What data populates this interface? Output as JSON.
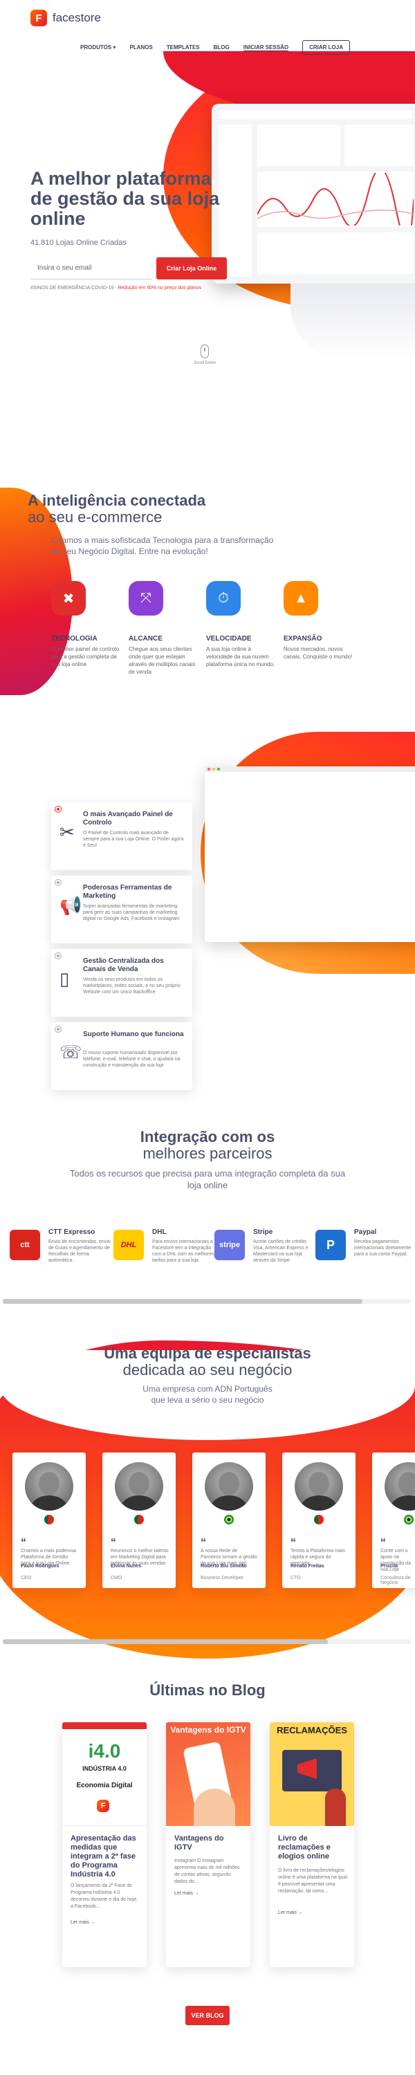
{
  "header": {
    "brand": "facestore",
    "nav": [
      {
        "label": "PRODUTOS ▾"
      },
      {
        "label": "PLANOS"
      },
      {
        "label": "TEMPLATES"
      },
      {
        "label": "BLOG"
      },
      {
        "label": "INICIAR SESSÃO"
      },
      {
        "label": "CRIAR LOJA"
      }
    ]
  },
  "hero": {
    "title_1": "A melhor plataforma",
    "title_2": "de gestão da sua loja",
    "title_3": "online",
    "stores": "41.810 Lojas Online Criadas",
    "email_placeholder": "Insira o seu email",
    "cta": "Criar Loja Online",
    "covid_prefix": "#SINOS DE EMERGÊNCIA COVID-19 -",
    "covid_offer": "Redução em 50% no preço dos planos",
    "scroll": "Scroll Down"
  },
  "intel": {
    "title_1": "A inteligência conectada",
    "title_2": "ao seu e-commerce",
    "sub_1": "Criamos a mais sofisticada Tecnologia para a transformação",
    "sub_2": "do seu Negócio Digital. Entre na evolução!",
    "features": [
      {
        "icon": "wrench-cross-icon",
        "title": "TECNOLOGIA",
        "text": "O melhor painel de controlo para a gestão completa da sua loja online",
        "color": "#e32c2c"
      },
      {
        "icon": "share-icon",
        "title": "ALCANCE",
        "text": "Chegue aos seus clientes onde quer que estejam através de múltiplos canais de venda",
        "color": "#8b3fd6"
      },
      {
        "icon": "stopwatch-icon",
        "title": "VELOCIDADE",
        "text": "A sua loja online à velocidade da sua nuvem plataforma única no mundo.",
        "color": "#2f86e8"
      },
      {
        "icon": "navigation-icon",
        "title": "EXPANSÃO",
        "text": "Novos mercados, novos canais, Conquiste o mundo!",
        "color": "#ff8a00"
      }
    ]
  },
  "capabilities": [
    {
      "icon": "tools-icon",
      "title": "O mais Avançado Painel de Controlo",
      "text": "O Painel de Controlo mais avançado de sempre para a sua Loja Online. O Poder agora é Seu!"
    },
    {
      "icon": "megaphone-icon",
      "title": "Poderosas Ferramentas de Marketing",
      "text": "Super avançadas ferramentas de marketing para gerir as suas campanhas de marketing digital no Google Ads, Facebook e Instagram"
    },
    {
      "icon": "devices-icon",
      "title": "Gestão Centralizada dos Canais de Venda",
      "text": "Venda os seus produtos em todos os marketplaces, redes sociais, e no seu próprio Website com um único Backoffice"
    },
    {
      "icon": "support-icon",
      "title": "Suporte Humano que funciona",
      "text": "O nosso suporte humanizado disponível por telefone, e-mail, telefone e chat, o ajudará na construção e manutenção da sua loja"
    }
  ],
  "integration": {
    "title_1": "Integração com os",
    "title_2": "melhores parceiros",
    "sub_1": "Todos os recursos que precisa para uma integração completa da sua",
    "sub_2": "loja online",
    "partners": [
      {
        "logo": "ctt",
        "name": "CTT Expresso",
        "text": "Envio de encomendas, envio de Guias e Agendamento de Recolhas de forma automática.",
        "color": "#d9261c"
      },
      {
        "logo": "DHL",
        "name": "DHL",
        "text": "Para envios internacionais a Facestore tem a integração com a DHL com as melhores tarifas para a sua loja",
        "color": "#ffcc00"
      },
      {
        "logo": "stripe",
        "name": "Stripe",
        "text": "Aceite cartões de crédito Visa, American Express e Mastercard na sua loja através da Stripe",
        "color": "#6772e5"
      },
      {
        "logo": "P",
        "name": "Paypal",
        "text": "Receba pagamentos internacionais diretamente para a sua conta Paypal.",
        "color": "#1f6fd1"
      }
    ]
  },
  "team": {
    "title_1": "Uma equipa de especialistas",
    "title_2": "dedicada ao seu negócio",
    "sub_1": "Uma empresa com ADN Português",
    "sub_2": "que leva a sério o seu negócio",
    "members": [
      {
        "quote": "Criamos a mais poderosa Plataforma de Gestão para a sua Loja Online",
        "name": "Paulo Rodrigues",
        "role": "CEO",
        "flag": "pt"
      },
      {
        "quote": "Reunimos o melhor talento em Marketing Digital para potenciar as suas vendas",
        "name": "Elvina Nunes",
        "role": "CMO",
        "flag": "pt"
      },
      {
        "quote": "A nossa Rede de Parceiros tornam a gestão da sua Loja mais ágil",
        "name": "Roberto Biu Simeão",
        "role": "Business Developer",
        "flag": "br"
      },
      {
        "quote": "Temos a Plataforma mais rápida e segura do mercado",
        "name": "Renato Freitas",
        "role": "CTO",
        "flag": "pt"
      },
      {
        "quote": "Conte com o apoio na construção da sua Loja",
        "name": "Priscila",
        "role": "Consultora de Negócio",
        "flag": "br"
      }
    ]
  },
  "blog": {
    "title": "Últimas no Blog",
    "posts": [
      {
        "img_big": "i4.0",
        "img_sub": "INDÚSTRIA 4.0",
        "img_cap": "Economia Digital",
        "title": "Apresentação das medidas que integram a 2ª fase do Programa Indústria 4.0",
        "text": "O lançamento da 2ª Fase do Programa Indústria 4.0 decorreu durante o dia de hoje, a Facebook...",
        "more": "Ler mais →"
      },
      {
        "img_big": "Vantagens do IGTV",
        "title": "Vantagens do IGTV",
        "text": "Instagram O Instagram apresenta mais de mil milhões de contas ativas, segundo dados do...",
        "more": "Ler mais →"
      },
      {
        "img_big": "RECLAMAÇÕES",
        "title": "Livro de reclamações e elogios online",
        "text": "O livro de reclamações/elogios online é uma plataforma na qual é possível apresentar uma reclamação, tal como...",
        "more": "Ler mais →"
      }
    ],
    "cta": "VER BLOG"
  },
  "colors": {
    "accent": "#e32c2c",
    "orange": "#ff6a00",
    "text": "#4a4f6a"
  }
}
